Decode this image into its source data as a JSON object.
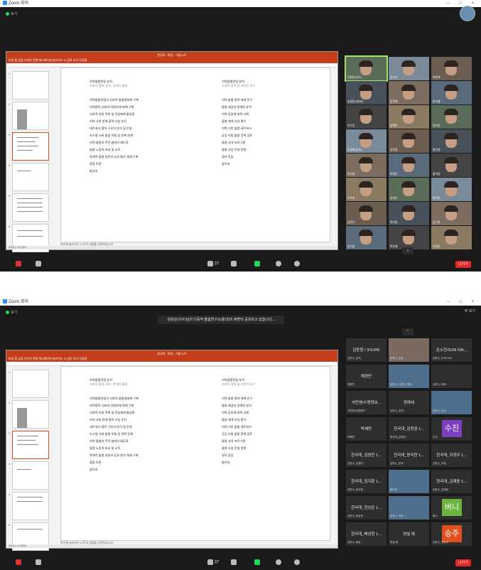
{
  "window": {
    "title": "Zoom 회의",
    "window_controls": "– □ ×"
  },
  "top": {
    "view_label": "보기",
    "view_label_b": "뷰 보기"
  },
  "banner_b": "강원순(사수)님의 다중적 돌봄연구소(분과)의 화면이 공유되고 있습니다...",
  "ppt": {
    "ribbon_title": "한국아 - 특강 - 그렙 노트",
    "ribbon_menu": "파일 홈 삽입 디자인 전환 애니메이션 슬라이드 쇼 검토 보기 도움말",
    "notes_text": "여기에 슬라이드 노트의 내용을 입력하십시오",
    "status_left": "슬라이드 3/3 한국어",
    "slide_left_header": [
      "지역돌봄연합 분석·",
      "사회적 협력, 자치, 관계적 돌봄"
    ],
    "slide_right_header": [
      "지역돌봄연합 분석·",
      "사회적 협력 및 이면적 연구"
    ],
    "left_items": [
      "지역돌봄연합의 사회적 돌봄생태계 구축",
      "지역협력 사회의 자원연계 체계 구축",
      "사회적 자원 목록 및 전달체계 활성화",
      "지역 사회 연계 협력 사업 추진",
      "네트워크 협력 구조의 분석 및 운영",
      "초고령 사회 돌봄 모델 및 정책 연계",
      "지역 돌봄과 주민 참여의 제도화",
      "돌봄 노동의 보호 및 교육",
      "관계적 돌봄 실천과 성과 평가 체계 구축",
      "종합 토론",
      "참가자"
    ],
    "right_items": [
      "지역 돌봄 협력 체계 연구",
      "돌봄 제공자 관계망 분석",
      "지역 공동체 회복 사례",
      "돌봄 체계 사업 평가",
      "지역 기반 돌봄 네트워크",
      "공공 지원 돌봄 정책 검토",
      "돌봄 교육 프로그램",
      "돌봄 사업 운영 방향",
      "질의 응답",
      "참가자"
    ]
  },
  "gallery_a": [
    "강원순(사수)",
    "장교수",
    "최원래",
    "송경문(2분과)",
    "김민채",
    "최수형",
    "이수진",
    "김해린",
    "장미선",
    "김경희(간사)",
    "김민정",
    "황인영",
    "박은영",
    "박정민",
    "황미영",
    "이수희",
    "강지은",
    "최지연",
    "김한나",
    "박미영",
    "김가영",
    "장기훈",
    "박민혜",
    "이정은"
  ],
  "gallery_b": [
    {
      "top": "김동원 / 3/소/RE",
      "bottom": "김판수_감지..."
    },
    {
      "top": "",
      "bottom": "김판수_공동..."
    },
    {
      "top": "손소진/SUN XIA...",
      "bottom": "김판수_SUN XIA..."
    },
    {
      "top": "채경민",
      "bottom": "채경민"
    },
    {
      "top": "",
      "bottom": "김판수_다양한_협동..."
    },
    {
      "top": "",
      "bottom": "김판수_박양..."
    },
    {
      "top": "서민영/수원정보...",
      "bottom": "서민영/수원정보..."
    },
    {
      "top": "정해세",
      "bottom": "김판수_유연..."
    },
    {
      "top": "",
      "bottom": "김판수_관심..."
    },
    {
      "top": "박혜연",
      "bottom": "박혜연"
    },
    {
      "top": "한국대_김정권 1...",
      "bottom": "한국대_김정권..."
    },
    {
      "top": "수진",
      "bottom": "수진"
    },
    {
      "top": "한국대_김정민 1...",
      "bottom": "김판수_김정민..."
    },
    {
      "top": "한국대_방국현 1...",
      "bottom": "김판수_방국..."
    },
    {
      "top": "한국대_지정우 1...",
      "bottom": "김판수_지정..."
    },
    {
      "top": "한국대_정지훈 1...",
      "bottom": "김판수_정지훈..."
    },
    {
      "top": "",
      "bottom": "황미경"
    },
    {
      "top": "한국대_김재윤 1...",
      "bottom": "김판수_김재윤..."
    },
    {
      "top": "한국대_한상준 1...",
      "bottom": "김판수_한상준..."
    },
    {
      "top": "",
      "bottom": "김판수_박양..."
    },
    {
      "top": "버니",
      "bottom": "버니"
    },
    {
      "top": "한국대_배상현 1...",
      "bottom": "김판수_배상..."
    },
    {
      "top": "영설 예",
      "bottom": "영설 예"
    },
    {
      "top": "승주",
      "bottom": "김판수_박승주..."
    }
  ],
  "toolbar": {
    "participants_count": "37",
    "leave": "나가기",
    "chev": "^",
    "chev_down": "v"
  },
  "colors": {
    "badge_purple": "#7c3fbf",
    "badge_green": "#6cb33f",
    "badge_red": "#e0501c",
    "leave_red": "#e02828",
    "ppt_accent": "#c43e1c",
    "speaker_outline": "#a6e36a"
  }
}
